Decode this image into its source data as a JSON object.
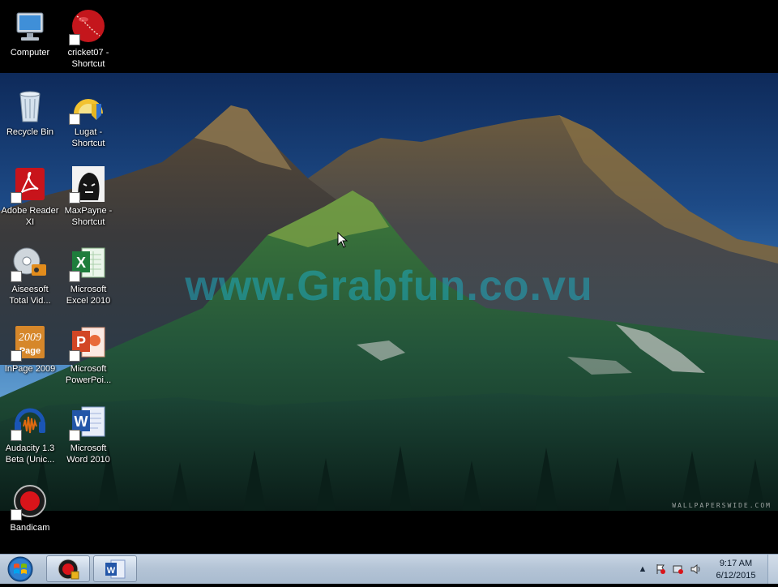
{
  "desktop": {
    "icons": [
      {
        "label": "Computer",
        "icon": "computer-icon",
        "shortcut": false
      },
      {
        "label": "cricket07 -\nShortcut",
        "icon": "cricket-ball-icon",
        "shortcut": true
      },
      {
        "label": "Recycle Bin",
        "icon": "recycle-bin-icon",
        "shortcut": false
      },
      {
        "label": "Lugat -\nShortcut",
        "icon": "lugat-icon",
        "shortcut": true
      },
      {
        "label": "Adobe Reader\nXI",
        "icon": "adobe-reader-icon",
        "shortcut": true
      },
      {
        "label": "MaxPayne -\nShortcut",
        "icon": "maxpayne-icon",
        "shortcut": true
      },
      {
        "label": "Aiseesoft\nTotal Vid...",
        "icon": "aiseesoft-icon",
        "shortcut": true
      },
      {
        "label": "Microsoft\nExcel 2010",
        "icon": "excel-icon",
        "shortcut": true
      },
      {
        "label": "InPage 2009",
        "icon": "inpage-icon",
        "shortcut": true
      },
      {
        "label": "Microsoft\nPowerPoi...",
        "icon": "powerpoint-icon",
        "shortcut": true
      },
      {
        "label": "Audacity 1.3\nBeta (Unic...",
        "icon": "audacity-icon",
        "shortcut": true
      },
      {
        "label": "Microsoft\nWord 2010",
        "icon": "word-icon",
        "shortcut": true
      },
      {
        "label": "Bandicam",
        "icon": "bandicam-icon",
        "shortcut": true
      }
    ]
  },
  "wallpaper": {
    "watermark": "www.Grabfun.co.vu",
    "credit": "WALLPAPERSWIDE.COM"
  },
  "taskbar": {
    "start_icon": "windows-start-icon",
    "pinned": [
      {
        "name": "Bandicam",
        "icon": "bandicam-icon"
      },
      {
        "name": "Microsoft Word",
        "icon": "word-icon"
      }
    ],
    "tray_icons": [
      "show-hidden-icons-chevron",
      "action-center-flag-icon",
      "network-icon",
      "volume-icon"
    ],
    "clock": {
      "time": "9:17 AM",
      "date": "6/12/2015"
    }
  }
}
